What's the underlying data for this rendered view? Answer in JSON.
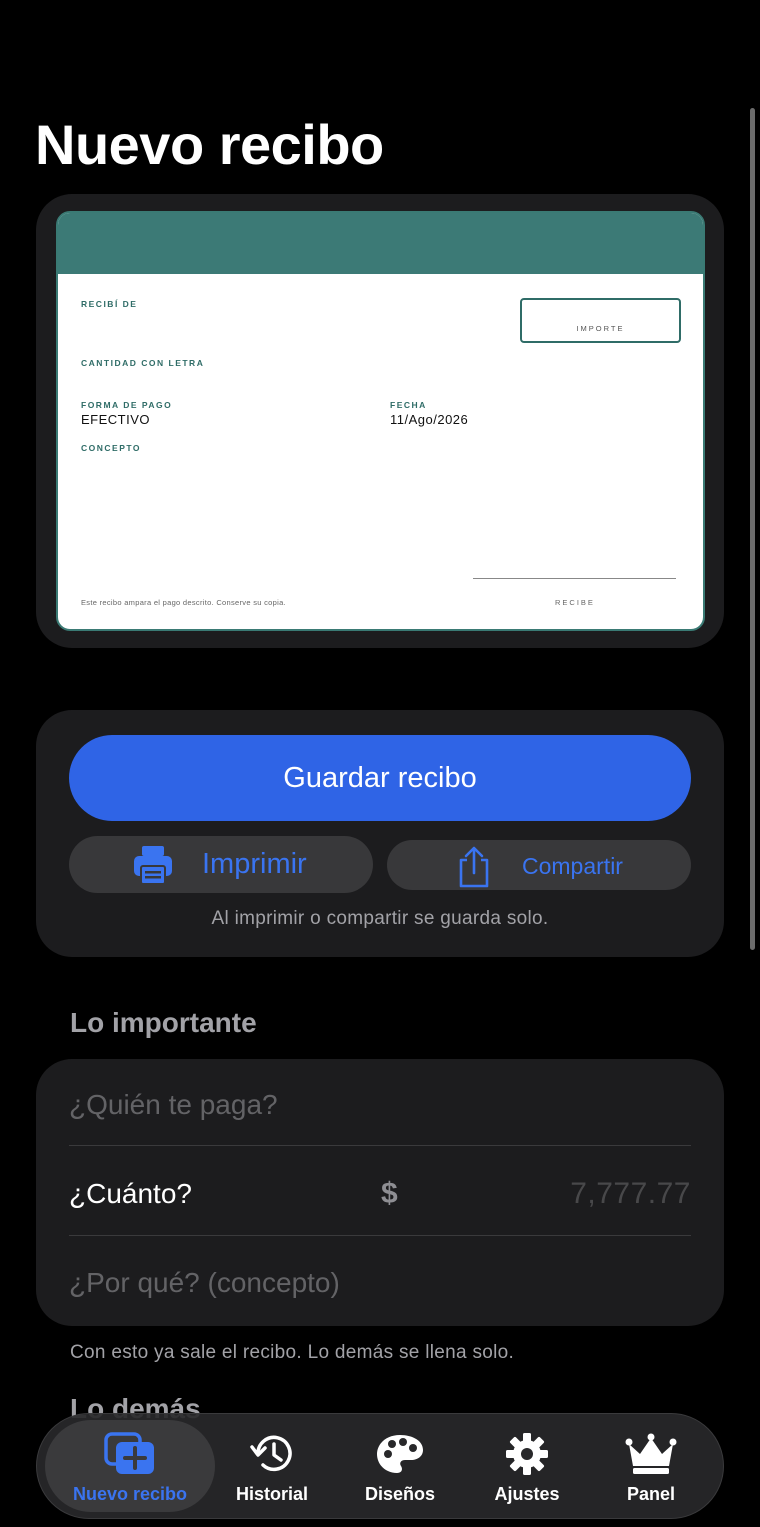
{
  "page": {
    "title": "Nuevo recibo"
  },
  "receipt": {
    "received_from_label": "RECIBÍ DE",
    "amount_label": "IMPORTE",
    "amount_words_label": "CANTIDAD CON LETRA",
    "payment_method_label": "FORMA DE PAGO",
    "payment_method_value": "EFECTIVO",
    "date_label": "FECHA",
    "date_value": "11/Ago/2026",
    "concept_label": "CONCEPTO",
    "footer_note": "Este recibo ampara el pago descrito. Conserve su copia.",
    "signature_label": "RECIBE",
    "accent_color": "#3c7a76"
  },
  "actions": {
    "save_label": "Guardar recibo",
    "print_label": "Imprimir",
    "share_label": "Compartir",
    "note": "Al imprimir o compartir se guarda solo.",
    "primary_color": "#2f64e6",
    "print_icon": "printer-icon",
    "share_icon": "share-icon"
  },
  "form": {
    "section_title": "Lo importante",
    "payer_placeholder": "¿Quién te paga?",
    "amount_label": "¿Cuánto?",
    "currency_symbol": "$",
    "amount_placeholder": "7,777.77",
    "concept_placeholder": "¿Por qué? (concepto)",
    "note": "Con esto ya sale el recibo. Lo demás se llena solo."
  },
  "more": {
    "section_title": "Lo demás"
  },
  "tabbar": {
    "items": [
      {
        "label": "Nuevo recibo",
        "icon": "new-receipt-icon",
        "active": true
      },
      {
        "label": "Historial",
        "icon": "history-icon",
        "active": false
      },
      {
        "label": "Diseños",
        "icon": "palette-icon",
        "active": false
      },
      {
        "label": "Ajustes",
        "icon": "gear-icon",
        "active": false
      },
      {
        "label": "Panel",
        "icon": "crown-icon",
        "active": false
      }
    ]
  }
}
